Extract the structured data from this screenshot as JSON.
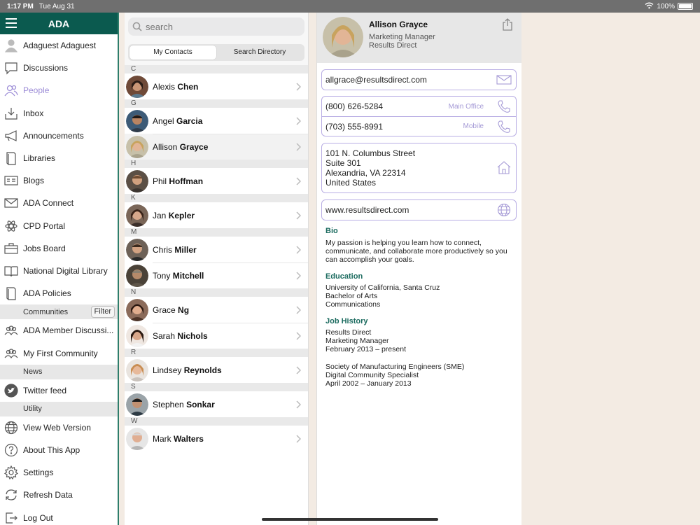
{
  "status": {
    "time": "1:17 PM",
    "date": "Tue Aug 31",
    "battery": "100%"
  },
  "sidebar": {
    "title": "ADA",
    "items": [
      {
        "label": "Adaguest Adaguest",
        "icon": "user-icon"
      },
      {
        "label": "Discussions",
        "icon": "chat-bubble-icon"
      },
      {
        "label": "People",
        "icon": "people-icon"
      },
      {
        "label": "Inbox",
        "icon": "inbox-icon"
      },
      {
        "label": "Announcements",
        "icon": "megaphone-icon"
      },
      {
        "label": "Libraries",
        "icon": "book-icon"
      },
      {
        "label": "Blogs",
        "icon": "blog-icon"
      },
      {
        "label": "ADA Connect",
        "icon": "envelope-icon"
      },
      {
        "label": "CPD Portal",
        "icon": "atom-icon"
      },
      {
        "label": "Jobs Board",
        "icon": "briefcase-icon"
      },
      {
        "label": "National Digital Library",
        "icon": "open-book-icon"
      },
      {
        "label": "ADA Policies",
        "icon": "book-icon"
      }
    ],
    "communities_label": "Communities",
    "filter_label": "Filter",
    "communities": [
      {
        "label": "ADA Member Discussi...",
        "icon": "group-icon"
      },
      {
        "label": "My First Community",
        "icon": "group-icon"
      }
    ],
    "news_label": "News",
    "news": [
      {
        "label": "Twitter feed",
        "icon": "twitter-icon"
      }
    ],
    "utility_label": "Utility",
    "utility": [
      {
        "label": "View Web Version",
        "icon": "globe-icon"
      },
      {
        "label": "About This App",
        "icon": "question-icon"
      },
      {
        "label": "Settings",
        "icon": "gear-icon"
      },
      {
        "label": "Refresh Data",
        "icon": "refresh-icon"
      },
      {
        "label": "Log Out",
        "icon": "logout-icon"
      }
    ]
  },
  "contacts": {
    "search_placeholder": "search",
    "tab_my": "My Contacts",
    "tab_dir": "Search Directory",
    "groups": [
      {
        "letter": "C",
        "people": [
          {
            "first": "Alexis",
            "last": "Chen"
          }
        ]
      },
      {
        "letter": "G",
        "people": [
          {
            "first": "Angel",
            "last": "Garcia"
          },
          {
            "first": "Allison",
            "last": "Grayce"
          }
        ]
      },
      {
        "letter": "H",
        "people": [
          {
            "first": "Phil",
            "last": "Hoffman"
          }
        ]
      },
      {
        "letter": "K",
        "people": [
          {
            "first": "Jan",
            "last": "Kepler"
          }
        ]
      },
      {
        "letter": "M",
        "people": [
          {
            "first": "Chris",
            "last": "Miller"
          },
          {
            "first": "Tony",
            "last": "Mitchell"
          }
        ]
      },
      {
        "letter": "N",
        "people": [
          {
            "first": "Grace",
            "last": "Ng"
          },
          {
            "first": "Sarah",
            "last": "Nichols"
          }
        ]
      },
      {
        "letter": "R",
        "people": [
          {
            "first": "Lindsey",
            "last": "Reynolds"
          }
        ]
      },
      {
        "letter": "S",
        "people": [
          {
            "first": "Stephen",
            "last": "Sonkar"
          }
        ]
      },
      {
        "letter": "W",
        "people": [
          {
            "first": "Mark",
            "last": "Walters"
          }
        ]
      }
    ]
  },
  "detail": {
    "name": "Allison Grayce",
    "title": "Marketing Manager",
    "company": "Results Direct",
    "email": "allgrace@resultsdirect.com",
    "phone1": "(800) 626-5284",
    "phone1_label": "Main Office",
    "phone2": "(703) 555-8991",
    "phone2_label": "Mobile",
    "address": [
      "101 N. Columbus Street",
      "Suite 301",
      "Alexandria, VA 22314",
      "United States"
    ],
    "website": "www.resultsdirect.com",
    "bio_title": "Bio",
    "bio": "My passion is helping you learn how to connect, communicate, and collaborate more productively so you can accomplish your goals.",
    "edu_title": "Education",
    "education": [
      "University of California, Santa Cruz",
      "Bachelor of Arts",
      "Communications"
    ],
    "job_title": "Job History",
    "jobs": [
      [
        "Results Direct",
        "Marketing Manager",
        "February 2013 – present"
      ],
      [
        "Society of Manufacturing Engineers (SME)",
        "Digital Community Specialist",
        "April 2002 – January 2013"
      ]
    ]
  }
}
